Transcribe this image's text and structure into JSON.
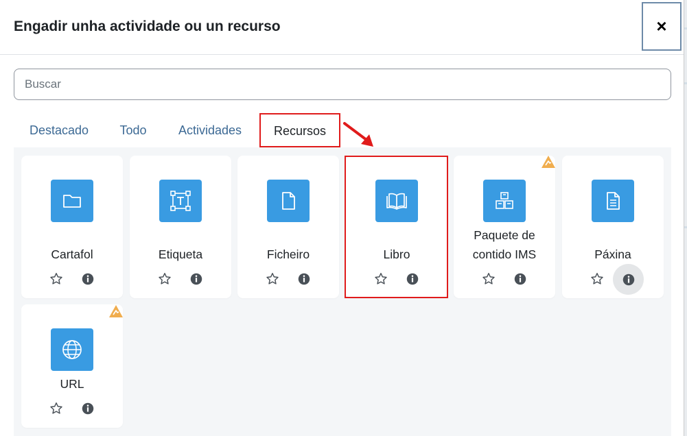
{
  "dialog": {
    "title": "Engadir unha actividade ou un recurso",
    "close_label": "×"
  },
  "search": {
    "placeholder": "Buscar",
    "value": ""
  },
  "tabs": [
    {
      "label": "Destacado",
      "active": false
    },
    {
      "label": "Todo",
      "active": false
    },
    {
      "label": "Actividades",
      "active": false
    },
    {
      "label": "Recursos",
      "active": true
    }
  ],
  "items": [
    {
      "name": "Cartafol",
      "icon": "folder-icon",
      "recommended": false
    },
    {
      "name": "Etiqueta",
      "icon": "text-label-icon",
      "recommended": false
    },
    {
      "name": "Ficheiro",
      "icon": "file-icon",
      "recommended": false
    },
    {
      "name": "Libro",
      "icon": "book-icon",
      "recommended": false
    },
    {
      "name_line1": "Paquete de",
      "name_line2": "contido IMS",
      "icon": "ims-package-icon",
      "recommended": true
    },
    {
      "name": "Páxina",
      "icon": "page-icon",
      "recommended": false
    },
    {
      "name": "URL",
      "icon": "globe-icon",
      "recommended": true
    }
  ],
  "colors": {
    "accent": "#399be2",
    "tab_link": "#3c6994",
    "highlight": "#e01b1b",
    "warning": "#f0ad4e"
  }
}
